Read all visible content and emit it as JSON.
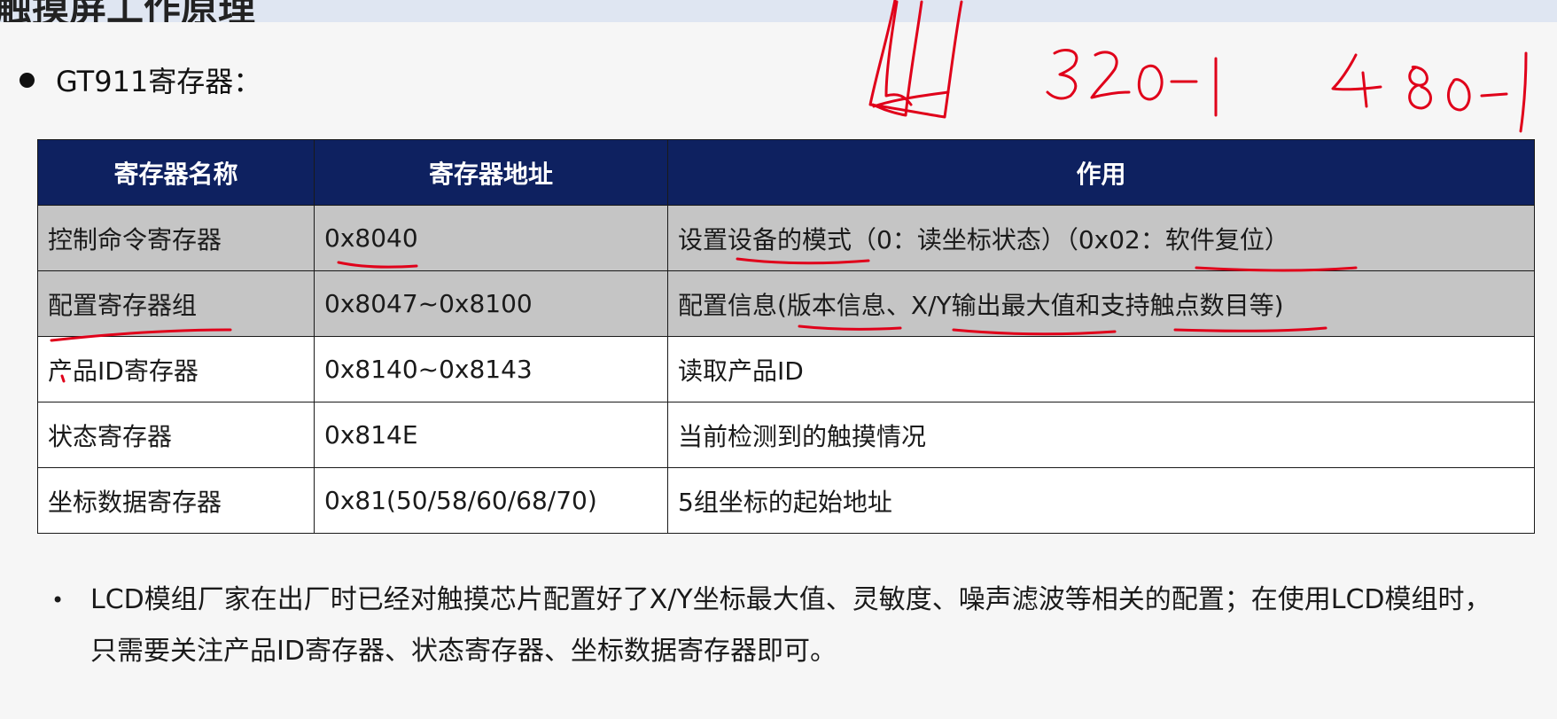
{
  "title": "触摸屏工作原理",
  "heading": "GT911寄存器：",
  "table": {
    "headers": [
      "寄存器名称",
      "寄存器地址",
      "作用"
    ],
    "rows": [
      {
        "name": "控制命令寄存器",
        "address": "0x8040",
        "function": "设置设备的模式（0：读坐标状态）（0x02：软件复位）"
      },
      {
        "name": "配置寄存器组",
        "address": "0x8047~0x8100",
        "function": "配置信息(版本信息、X/Y输出最大值和支持触点数目等)"
      },
      {
        "name": "产品ID寄存器",
        "address": "0x8140~0x8143",
        "function": "读取产品ID"
      },
      {
        "name": "状态寄存器",
        "address": "0x814E",
        "function": "当前检测到的触摸情况"
      },
      {
        "name": "坐标数据寄存器",
        "address": "0x81(50/58/60/68/70)",
        "function": "5组坐标的起始地址"
      }
    ]
  },
  "note": "LCD模组厂家在出厂时已经对触摸芯片配置好了X/Y坐标最大值、灵敏度、噪声滤波等相关的配置；在使用LCD模组时，只需要关注产品ID寄存器、状态寄存器、坐标数据寄存器即可。",
  "colors": {
    "header_bg": "#0e2160",
    "shaded_row": "#c5c5c5",
    "ink": "#e0001a"
  }
}
